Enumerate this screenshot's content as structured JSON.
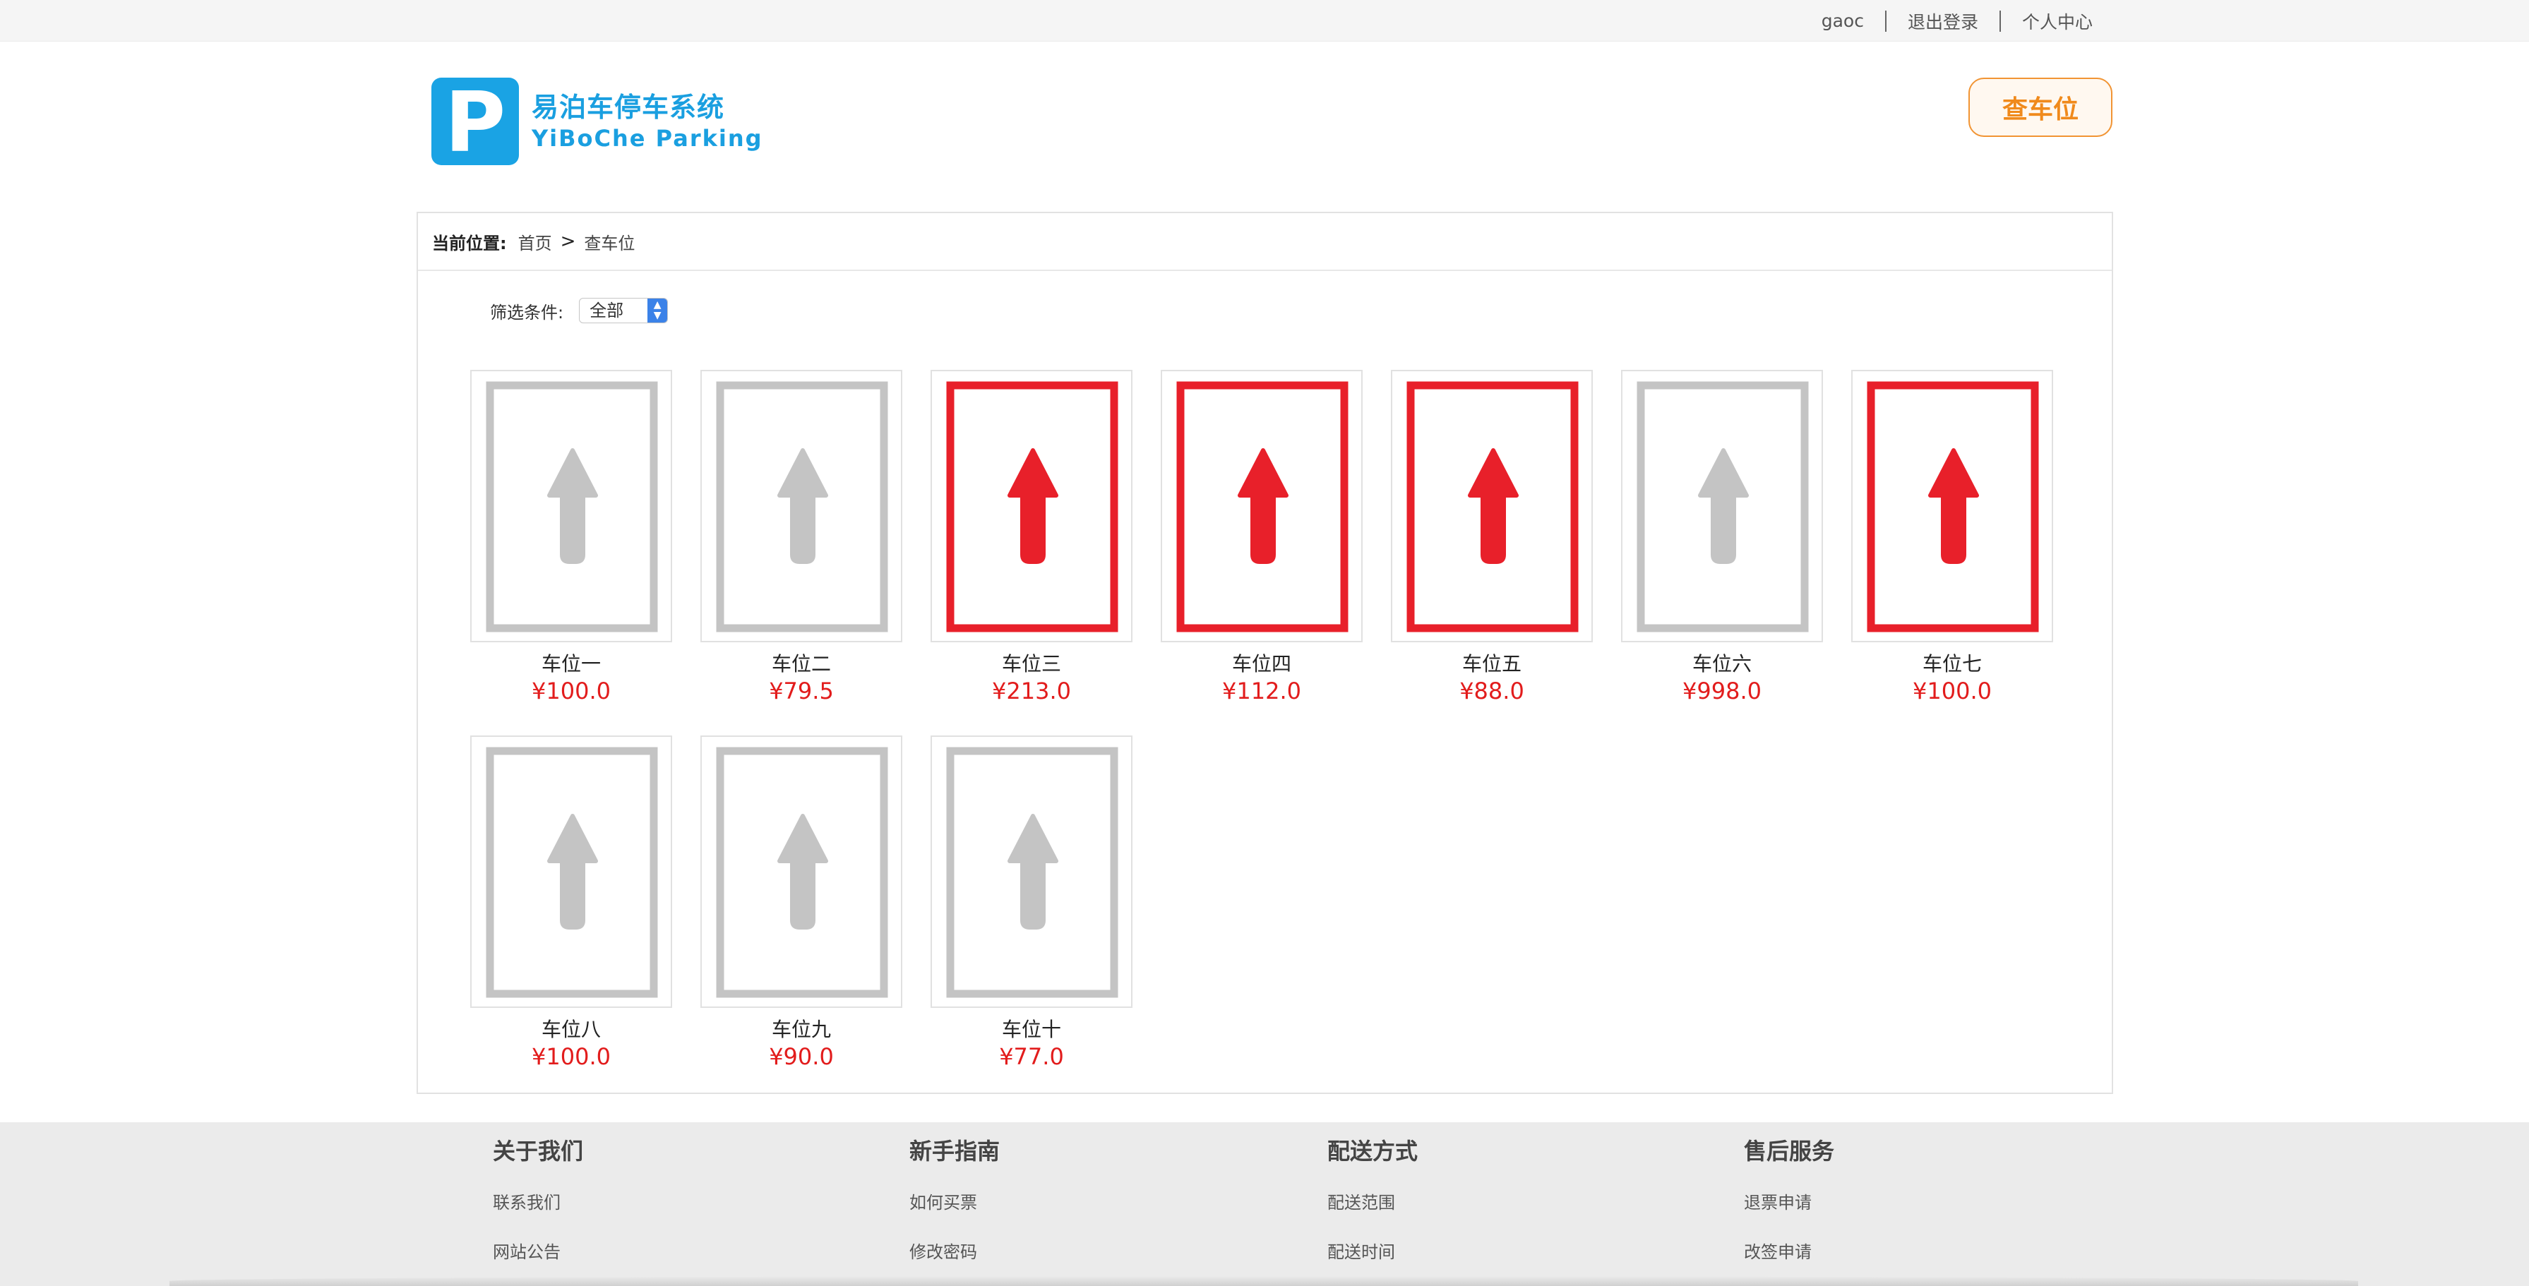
{
  "topbar": {
    "username": "gaoc",
    "logout": "退出登录",
    "profile": "个人中心"
  },
  "logo": {
    "letter": "P",
    "title_cn": "易泊车停车系统",
    "title_en": "YiBoChe  Parking"
  },
  "header": {
    "find_button": "查车位"
  },
  "breadcrumb": {
    "label": "当前位置:",
    "home": "首页",
    "separator": ">",
    "current": "查车位"
  },
  "filter": {
    "label": "筛选条件:",
    "selected": "全部"
  },
  "spots": [
    {
      "name": "车位一",
      "price": "¥100.0",
      "status": "available"
    },
    {
      "name": "车位二",
      "price": "¥79.5",
      "status": "available"
    },
    {
      "name": "车位三",
      "price": "¥213.0",
      "status": "occupied"
    },
    {
      "name": "车位四",
      "price": "¥112.0",
      "status": "occupied"
    },
    {
      "name": "车位五",
      "price": "¥88.0",
      "status": "occupied"
    },
    {
      "name": "车位六",
      "price": "¥998.0",
      "status": "available"
    },
    {
      "name": "车位七",
      "price": "¥100.0",
      "status": "occupied"
    },
    {
      "name": "车位八",
      "price": "¥100.0",
      "status": "available"
    },
    {
      "name": "车位九",
      "price": "¥90.0",
      "status": "available"
    },
    {
      "name": "车位十",
      "price": "¥77.0",
      "status": "available"
    }
  ],
  "colors": {
    "available": "#c4c4c4",
    "occupied": "#e8202a",
    "brand": "#1aa3e4",
    "accent": "#f08a1c",
    "price": "#e21c1c"
  },
  "footer": {
    "columns": [
      {
        "title": "关于我们",
        "links": [
          "联系我们",
          "网站公告"
        ]
      },
      {
        "title": "新手指南",
        "links": [
          "如何买票",
          "修改密码"
        ]
      },
      {
        "title": "配送方式",
        "links": [
          "配送范围",
          "配送时间"
        ]
      },
      {
        "title": "售后服务",
        "links": [
          "退票申请",
          "改签申请"
        ]
      }
    ]
  }
}
